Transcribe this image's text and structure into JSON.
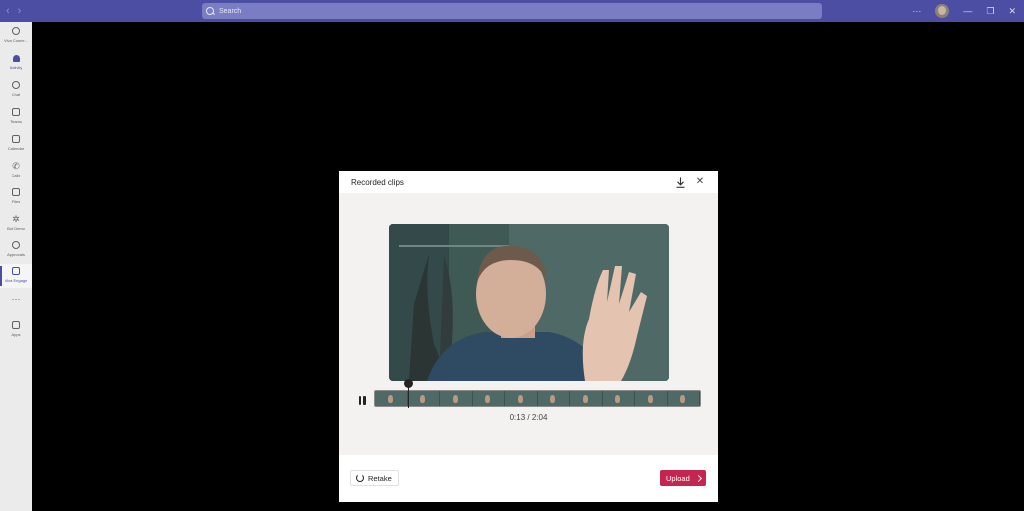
{
  "titlebar": {
    "back_glyph": "‹",
    "forward_glyph": "›",
    "search_placeholder": "Search",
    "more_glyph": "···",
    "minimize_glyph": "—",
    "restore_glyph": "❐",
    "close_glyph": "✕"
  },
  "rail": {
    "items": [
      {
        "label": "Viva Conne...",
        "icon": "connections-icon"
      },
      {
        "label": "Activity",
        "icon": "bell-icon"
      },
      {
        "label": "Chat",
        "icon": "chat-icon"
      },
      {
        "label": "Teams",
        "icon": "teams-icon"
      },
      {
        "label": "Calendar",
        "icon": "calendar-icon"
      },
      {
        "label": "Calls",
        "icon": "phone-icon"
      },
      {
        "label": "Files",
        "icon": "file-icon"
      },
      {
        "label": "Bot Demo",
        "icon": "bot-icon"
      },
      {
        "label": "Approvals",
        "icon": "approvals-icon"
      },
      {
        "label": "Viva Engage",
        "icon": "engage-icon"
      },
      {
        "label": "Apps",
        "icon": "apps-icon"
      }
    ],
    "more_glyph": "···"
  },
  "modal": {
    "title": "Recorded clips",
    "timecode": "0:13 / 2:04",
    "playback_progress": 0.105,
    "retake_label": "Retake",
    "upload_label": "Upload",
    "close_glyph": "✕"
  },
  "colors": {
    "titlebar": "#4b4ea3",
    "accent": "#4b4ea3",
    "upload": "#c4264f"
  }
}
